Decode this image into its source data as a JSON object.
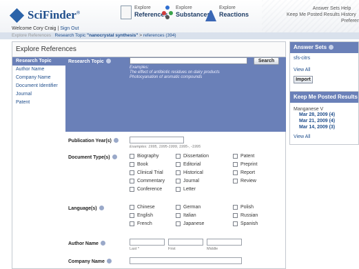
{
  "header": {
    "logo": "SciFinder",
    "logo_mark": "®",
    "nav": [
      {
        "line1": "Explore",
        "line2": "References",
        "icon": "document-icon"
      },
      {
        "line1": "Explore",
        "line2": "Substances",
        "icon": "molecule-icon"
      },
      {
        "line1": "Explore",
        "line2": "Reactions",
        "icon": "flask-icon"
      }
    ],
    "right_links": {
      "answer_sets": "Answer Sets",
      "kmp": "Keep Me Posted Results",
      "help": "Help",
      "history": "History",
      "preferences": "Preferences"
    },
    "welcome": "Welcome Cory Craig",
    "separator": "|",
    "sign_out": "Sign Out"
  },
  "breadcrumb": {
    "home": "Explore References",
    "topic_prefix": "Research Topic",
    "topic_value": "\"nanocrystal synthesis\"",
    "arrow": ">",
    "references": "references (394)"
  },
  "panel": {
    "title": "Explore References",
    "nav_items": [
      "Research Topic",
      "Author Name",
      "Company Name",
      "Document Identifier",
      "Journal",
      "Patent"
    ],
    "research_topic": {
      "label": "Research Topic",
      "search_button": "Search",
      "examples_title": "Examples:",
      "example1": "The effect of antibiotic residues on dairy products",
      "example2": "Photocyanation of aromatic compounds"
    },
    "publication_year": {
      "label": "Publication Year(s)",
      "hint": "Examples: 1995, 1995-1999, 1995-, -1995"
    },
    "document_types": {
      "label": "Document Type(s)",
      "options": [
        [
          "Biography",
          "Dissertation",
          "Patent"
        ],
        [
          "Book",
          "Editorial",
          "Preprint"
        ],
        [
          "Clinical Trial",
          "Historical",
          "Report"
        ],
        [
          "Commentary",
          "Journal",
          "Review"
        ],
        [
          "Conference",
          "Letter",
          ""
        ]
      ]
    },
    "languages": {
      "label": "Language(s)",
      "options": [
        [
          "Chinese",
          "German",
          "Polish"
        ],
        [
          "English",
          "Italian",
          "Russian"
        ],
        [
          "French",
          "Japanese",
          "Spanish"
        ]
      ]
    },
    "author_name": {
      "label": "Author Name",
      "last": "Last *",
      "first": "First",
      "middle": "Middle"
    },
    "company_name": {
      "label": "Company Name"
    }
  },
  "side_answer_sets": {
    "title": "Answer Sets",
    "item": "sfs-citrs",
    "view_all": "View All",
    "import": "Import"
  },
  "side_kmp": {
    "title": "Keep Me Posted Results",
    "name": "Manganese V",
    "dates": [
      "Mar 28, 2009 (4)",
      "Mar 21, 2009 (4)",
      "Mar 14, 2009 (3)"
    ],
    "view_all": "View All"
  },
  "colors": {
    "panel_blue": "#6a80b8",
    "link_blue": "#1f4e8c",
    "crumb_bg": "#d9e1ec"
  }
}
